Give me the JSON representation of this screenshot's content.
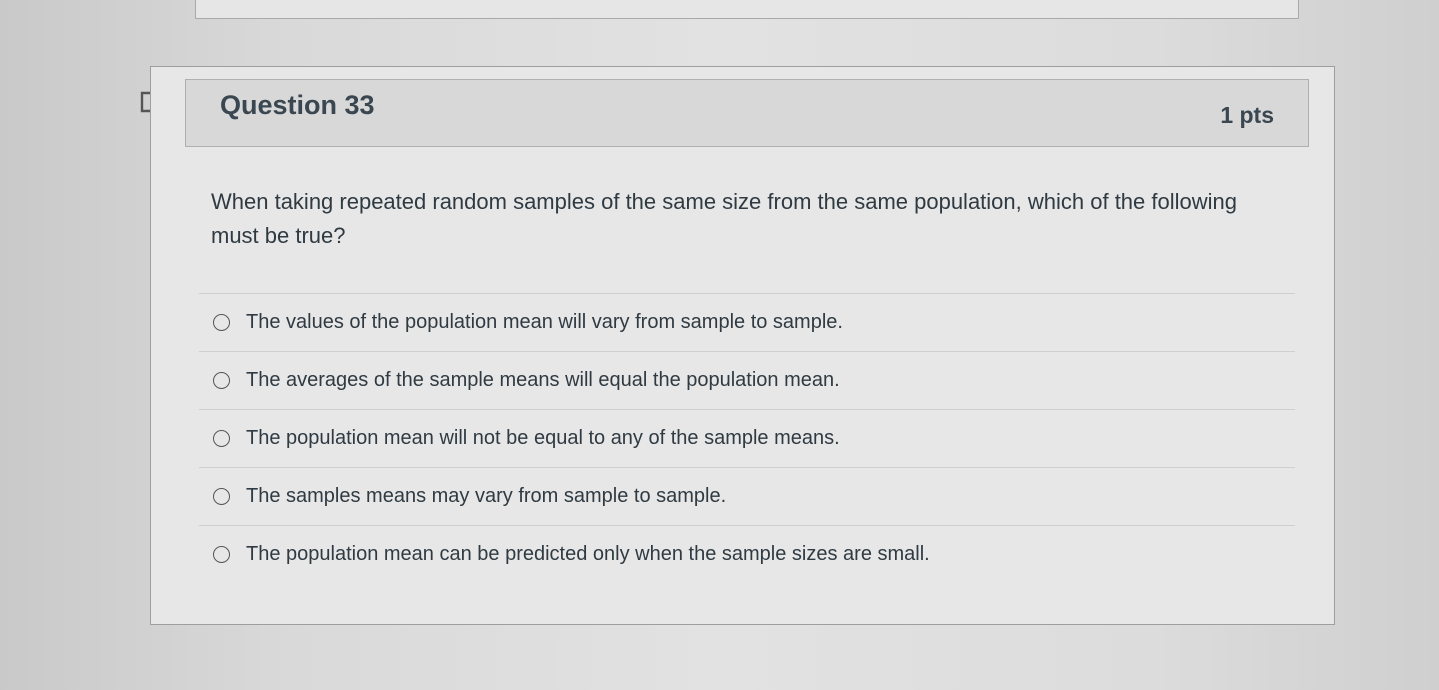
{
  "question": {
    "title": "Question 33",
    "points": "1 pts",
    "text": "When taking repeated random samples of the same size from the same population, which of the following must be true?",
    "flag_icon": "flag-outline-icon"
  },
  "answers": [
    {
      "label": "The values of the population mean will vary from sample to sample."
    },
    {
      "label": "The averages of the sample means will equal the population mean."
    },
    {
      "label": "The population mean will not be equal to any of the sample means."
    },
    {
      "label": "The samples means may vary from sample to sample."
    },
    {
      "label": "The population mean can be predicted only when the sample sizes are small."
    }
  ]
}
